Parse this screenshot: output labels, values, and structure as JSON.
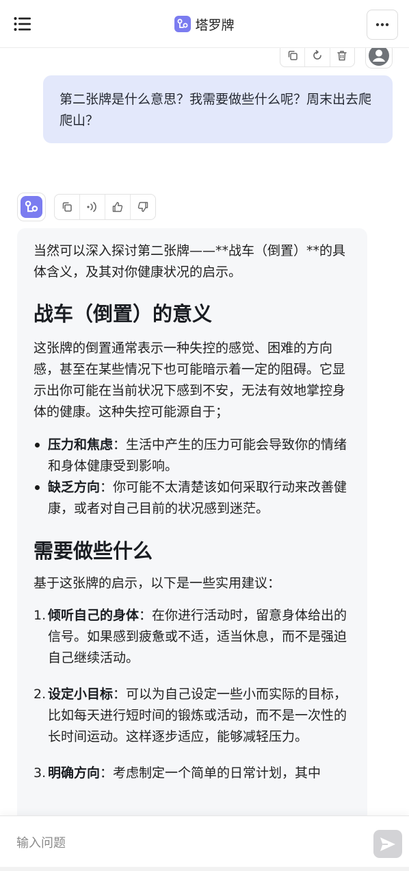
{
  "header": {
    "title": "塔罗牌",
    "menu_icon": "hamburger-menu-icon",
    "more_icon": "ellipsis-icon"
  },
  "user_message": {
    "text": "第二张牌是什么意思？我需要做些什么呢？周末出去爬爬山？",
    "actions": [
      "copy-icon",
      "regenerate-icon",
      "trash-icon"
    ]
  },
  "assistant_message": {
    "actions": [
      "copy-icon",
      "speaker-icon",
      "thumbs-up-icon",
      "thumbs-down-icon"
    ],
    "intro": "当然可以深入探讨第二张牌——**战车（倒置）**的具体含义，及其对你健康状况的启示。",
    "heading1": "战车（倒置）的意义",
    "para1": "这张牌的倒置通常表示一种失控的感觉、困难的方向感，甚至在某些情况下也可能暗示着一定的阻碍。它显示出你可能在当前状况下感到不安，无法有效地掌控身体的健康。这种失控可能源自于；",
    "bullets": [
      {
        "title": "压力和焦虑",
        "text": "：生活中产生的压力可能会导致你的情绪和身体健康受到影响。"
      },
      {
        "title": "缺乏方向",
        "text": "：你可能不太清楚该如何采取行动来改善健康，或者对自己目前的状况感到迷茫。"
      }
    ],
    "heading2": "需要做些什么",
    "para2": "基于这张牌的启示，以下是一些实用建议：",
    "steps": [
      {
        "num": "1.",
        "title": "倾听自己的身体",
        "text": "：在你进行活动时，留意身体给出的信号。如果感到疲惫或不适，适当休息，而不是强迫自己继续活动。"
      },
      {
        "num": "2.",
        "title": "设定小目标",
        "text": "：可以为自己设定一些小而实际的目标，比如每天进行短时间的锻炼或活动，而不是一次性的长时间运动。这样逐步适应，能够减轻压力。"
      },
      {
        "num": "3.",
        "title": "明确方向",
        "text": "：考虑制定一个简单的日常计划，其中"
      }
    ]
  },
  "input": {
    "placeholder": "输入问题",
    "value": ""
  },
  "colors": {
    "brand": "#7b7cf0",
    "user_bubble": "#e3e8fb",
    "bot_bubble": "#f6f7f9",
    "send_button": "#d3d3d6"
  }
}
